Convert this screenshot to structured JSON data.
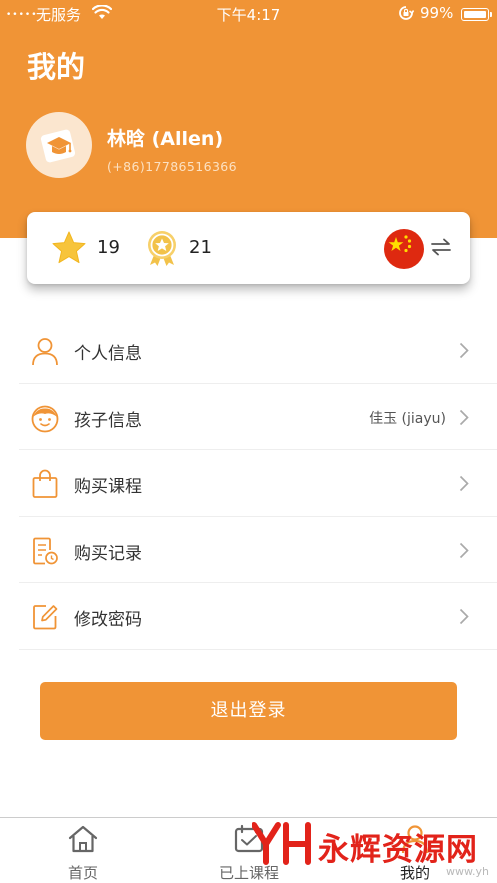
{
  "status_bar": {
    "signal_dots": "•••••",
    "carrier": "无服务",
    "time": "下午4:17",
    "battery_percent": "99%",
    "icons": [
      "wifi-icon",
      "orientation-lock-icon",
      "battery-icon"
    ]
  },
  "header": {
    "title": "我的",
    "background_color": "#F09436"
  },
  "profile": {
    "name": "林晗 (Allen)",
    "phone": "(+86)17786516366",
    "avatar_icon": "graduation-cap-icon"
  },
  "stats": {
    "stars": "19",
    "medals": "21",
    "language_flag": "china-flag-icon",
    "swap_icon": "swap-arrows-icon"
  },
  "menu": {
    "items": [
      {
        "label": "个人信息",
        "icon": "person-icon",
        "value": ""
      },
      {
        "label": "孩子信息",
        "icon": "child-face-icon",
        "value": "佳玉 (jiayu)"
      },
      {
        "label": "购买课程",
        "icon": "shopping-bag-icon",
        "value": ""
      },
      {
        "label": "购买记录",
        "icon": "receipt-clock-icon",
        "value": ""
      },
      {
        "label": "修改密码",
        "icon": "edit-icon",
        "value": ""
      }
    ]
  },
  "logout": {
    "label": "退出登录"
  },
  "tabbar": {
    "tabs": [
      {
        "label": "首页",
        "icon": "home-icon",
        "active": false
      },
      {
        "label": "已上课程",
        "icon": "calendar-icon",
        "active": false
      },
      {
        "label": "我的",
        "icon": "profile-icon",
        "active": true
      }
    ]
  },
  "watermark": {
    "text": "永辉资源网",
    "url": "www.yh",
    "logo": "yh-logo-icon"
  },
  "colors": {
    "accent": "#F09436",
    "watermark_red": "#E2231A"
  }
}
